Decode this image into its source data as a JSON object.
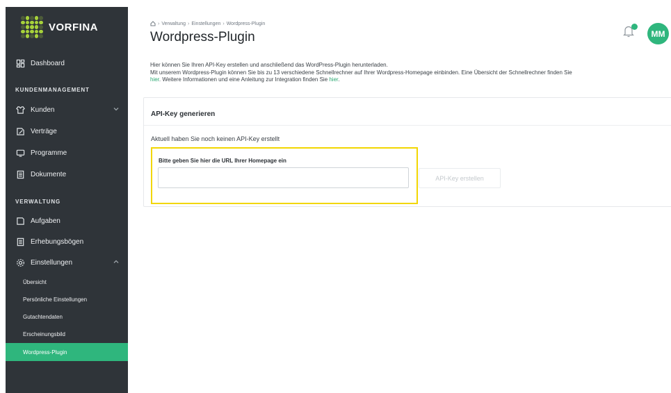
{
  "sidebar": {
    "brand": "VORFINA",
    "dashboard": "Dashboard",
    "section_kunden": "KUNDENMANAGEMENT",
    "kunden": "Kunden",
    "vertraege": "Verträge",
    "programme": "Programme",
    "dokumente": "Dokumente",
    "section_verwaltung": "VERWALTUNG",
    "aufgaben": "Aufgaben",
    "erhebungsboegen": "Erhebungsbögen",
    "einstellungen": "Einstellungen",
    "sub_items": [
      "Übersicht",
      "Persönliche Einstellungen",
      "Gutachtendaten",
      "Erscheinungsbild",
      "Wordpress-Plugin"
    ],
    "active_sub": "Wordpress-Plugin"
  },
  "header": {
    "breadcrumb": [
      "Verwaltung",
      "Einstellungen",
      "Wordpress-Plugin"
    ],
    "title": "Wordpress-Plugin",
    "avatar_initials": "MM"
  },
  "intro": {
    "line1": "Hier können Sie Ihren API-Key erstellen und anschließend das WordPress-Plugin herunterladen.",
    "line2": "Mit unserem Wordpress-Plugin können Sie bis zu 13 verschiedene Schnellrechner auf Ihrer Wordpress-Homepage einbinden. Eine Übersicht der Schnellrechner finden Sie",
    "link1": "hier",
    "line3": ". Weitere Informationen und eine Anleitung zur Integration finden Sie ",
    "link2": "hier",
    "line3_end": "."
  },
  "card": {
    "title": "API-Key generieren",
    "status": "Aktuell haben Sie noch keinen API-Key erstellt",
    "field_label": "Bitte geben Sie hier die URL Ihrer Homepage ein",
    "input_value": "",
    "button_label": "API-Key erstellen"
  },
  "colors": {
    "sidebar_bg": "#2f3439",
    "accent": "#2fb67d",
    "highlight": "#f2d600",
    "link": "#2aa872"
  },
  "icons": [
    "dashboard-icon",
    "kunden-icon",
    "vertraege-icon",
    "programme-icon",
    "dokumente-icon",
    "aufgaben-icon",
    "erhebungsboegen-icon",
    "einstellungen-icon",
    "home-icon",
    "bell-icon"
  ]
}
